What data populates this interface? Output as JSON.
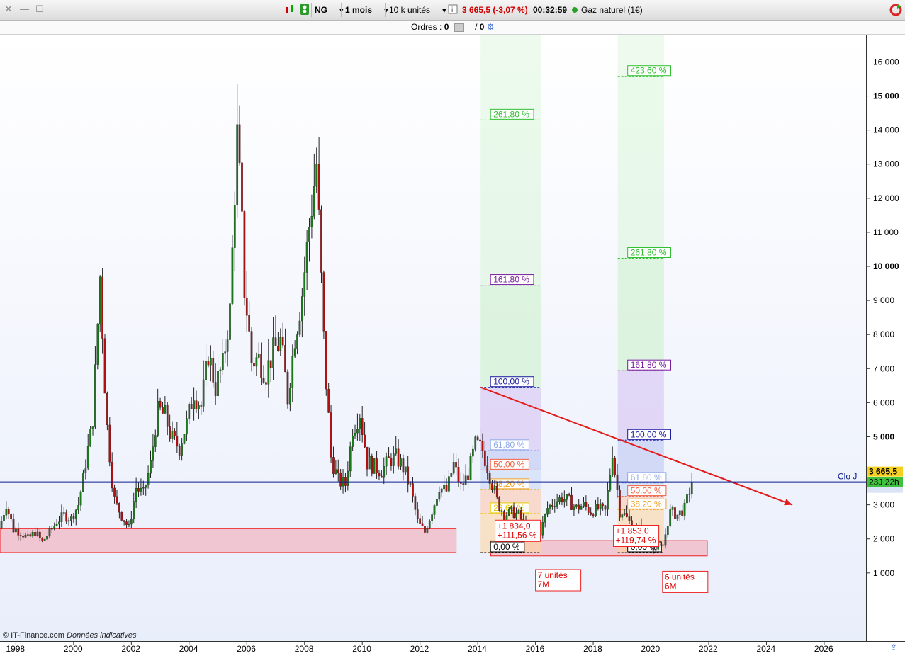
{
  "toolbar": {
    "symbol": "NG",
    "period": "1 mois",
    "units": "10 k unités",
    "price_change": "3 665,5 (-3,07 %)",
    "timer": "00:32:59",
    "instrument": "Gaz naturel (1€)",
    "orders_label": "Ordres :",
    "orders_a": "0",
    "orders_b": "0",
    "orders_sep": "/"
  },
  "footer": {
    "source": "© IT-Finance.com",
    "note": "Données indicatives"
  },
  "price_tags": {
    "last": "3 665,5",
    "countdown": "23J 22h",
    "clo_label": "Clo J",
    "hidden_tag": "3 665,5"
  },
  "colors": {
    "up": "#1a7a1a",
    "down": "#b01010",
    "clo_line": "#0b1f8f",
    "trend": "#e31b1b",
    "support_zone": "#f2aab5"
  },
  "chart_data": {
    "type": "candlestick",
    "title": "",
    "y_ticks": [
      1000,
      2000,
      3000,
      4000,
      5000,
      6000,
      7000,
      8000,
      9000,
      10000,
      11000,
      12000,
      13000,
      14000,
      15000,
      16000
    ],
    "y_tick_labels": [
      "1 000",
      "2 000",
      "3 000",
      "4 000",
      "5 000",
      "6 000",
      "7 000",
      "8 000",
      "9 000",
      "10 000",
      "11 000",
      "12 000",
      "13 000",
      "14 000",
      "15 000",
      "16 000"
    ],
    "y_tick_bold": [
      false,
      false,
      false,
      false,
      true,
      false,
      false,
      false,
      false,
      true,
      false,
      false,
      false,
      false,
      true,
      false
    ],
    "ylim": [
      -1000,
      16800
    ],
    "x_ticks": [
      1998,
      2000,
      2002,
      2004,
      2006,
      2008,
      2010,
      2012,
      2014,
      2016,
      2018,
      2020,
      2022,
      2024,
      2026
    ],
    "xlim": [
      1997.45,
      2027.45
    ],
    "last_price": 3665.5,
    "monthly_closes": [
      [
        1997.5,
        2300
      ],
      [
        1997.75,
        3000
      ],
      [
        1998.0,
        2300
      ],
      [
        1998.25,
        2200
      ],
      [
        1998.5,
        2000
      ],
      [
        1998.75,
        2200
      ],
      [
        1999.0,
        1900
      ],
      [
        1999.25,
        2200
      ],
      [
        1999.5,
        2500
      ],
      [
        1999.75,
        2700
      ],
      [
        2000.0,
        2600
      ],
      [
        2000.25,
        3000
      ],
      [
        2000.5,
        4200
      ],
      [
        2000.75,
        5500
      ],
      [
        2001.0,
        9700
      ],
      [
        2001.25,
        5200
      ],
      [
        2001.5,
        3100
      ],
      [
        2001.75,
        2700
      ],
      [
        2002.0,
        2300
      ],
      [
        2002.25,
        3500
      ],
      [
        2002.5,
        3300
      ],
      [
        2002.75,
        4200
      ],
      [
        2003.0,
        5800
      ],
      [
        2003.25,
        5600
      ],
      [
        2003.5,
        4900
      ],
      [
        2003.75,
        4700
      ],
      [
        2004.0,
        5400
      ],
      [
        2004.25,
        6300
      ],
      [
        2004.5,
        5900
      ],
      [
        2004.75,
        7400
      ],
      [
        2005.0,
        6500
      ],
      [
        2005.25,
        7100
      ],
      [
        2005.5,
        8700
      ],
      [
        2005.75,
        13900
      ],
      [
        2006.0,
        9500
      ],
      [
        2006.25,
        7200
      ],
      [
        2006.5,
        7300
      ],
      [
        2006.75,
        6900
      ],
      [
        2007.0,
        7500
      ],
      [
        2007.25,
        7800
      ],
      [
        2007.5,
        6200
      ],
      [
        2007.75,
        7900
      ],
      [
        2008.0,
        9200
      ],
      [
        2008.25,
        11200
      ],
      [
        2008.5,
        13000
      ],
      [
        2008.75,
        7700
      ],
      [
        2009.0,
        4400
      ],
      [
        2009.25,
        3700
      ],
      [
        2009.5,
        3600
      ],
      [
        2009.75,
        5200
      ],
      [
        2010.0,
        5700
      ],
      [
        2010.25,
        4300
      ],
      [
        2010.5,
        4100
      ],
      [
        2010.75,
        4000
      ],
      [
        2011.0,
        4300
      ],
      [
        2011.25,
        4400
      ],
      [
        2011.5,
        4100
      ],
      [
        2011.75,
        3500
      ],
      [
        2012.0,
        2500
      ],
      [
        2012.25,
        2200
      ],
      [
        2012.5,
        2800
      ],
      [
        2012.75,
        3500
      ],
      [
        2013.0,
        3400
      ],
      [
        2013.25,
        4200
      ],
      [
        2013.5,
        3500
      ],
      [
        2013.75,
        3900
      ],
      [
        2014.0,
        4800
      ],
      [
        2014.25,
        4600
      ],
      [
        2014.5,
        3900
      ],
      [
        2014.75,
        3100
      ],
      [
        2015.0,
        2700
      ],
      [
        2015.25,
        2800
      ],
      [
        2015.5,
        2700
      ],
      [
        2015.75,
        2300
      ],
      [
        2016.0,
        2000
      ],
      [
        2016.25,
        2200
      ],
      [
        2016.5,
        2900
      ],
      [
        2016.75,
        3100
      ],
      [
        2017.0,
        3200
      ],
      [
        2017.25,
        3100
      ],
      [
        2017.5,
        2900
      ],
      [
        2017.75,
        3000
      ],
      [
        2018.0,
        2800
      ],
      [
        2018.25,
        2900
      ],
      [
        2018.5,
        2800
      ],
      [
        2018.75,
        4500
      ],
      [
        2019.0,
        2900
      ],
      [
        2019.25,
        2600
      ],
      [
        2019.5,
        2300
      ],
      [
        2019.75,
        2300
      ],
      [
        2020.0,
        1900
      ],
      [
        2020.25,
        1700
      ],
      [
        2020.5,
        1800
      ],
      [
        2020.75,
        2800
      ],
      [
        2021.0,
        2700
      ],
      [
        2021.25,
        2900
      ],
      [
        2021.5,
        3665
      ]
    ],
    "support_zones": [
      {
        "x0": 1997.45,
        "x1": 2013.25,
        "y0": 1600,
        "y1": 2300
      },
      {
        "x0": 2014.45,
        "x1": 2021.95,
        "y0": 1500,
        "y1": 1950
      }
    ],
    "trendline": {
      "x0": 2014.1,
      "y0": 6450,
      "x1": 2024.9,
      "y1": 3000
    },
    "fib_projections": [
      {
        "x0": 2014.1,
        "x1": 2016.2,
        "base": 1600,
        "ref": 6450,
        "levels": [
          {
            "label": "0,00 %",
            "ratio": 0,
            "color": "#000000"
          },
          {
            "label": "23,60 %",
            "ratio": 0.236,
            "color": "#e8c800"
          },
          {
            "label": "38,20 %",
            "ratio": 0.382,
            "color": "#f0a020"
          },
          {
            "label": "50,00 %",
            "ratio": 0.5,
            "color": "#f06040"
          },
          {
            "label": "61,80 %",
            "ratio": 0.618,
            "color": "#8fa8e8"
          },
          {
            "label": "100,00 %",
            "ratio": 1.0,
            "color": "#1a1aa0"
          },
          {
            "label": "161,80 %",
            "ratio": 1.618,
            "color": "#7a1aa0"
          },
          {
            "label": "261,80 %",
            "ratio": 2.618,
            "color": "#30c030"
          }
        ]
      },
      {
        "x0": 2018.85,
        "x1": 2020.45,
        "base": 1600,
        "ref": 4900,
        "levels": [
          {
            "label": "0,00 %",
            "ratio": 0,
            "color": "#000000"
          },
          {
            "label": "38,20 %",
            "ratio": 0.382,
            "color": "#f0a020"
          },
          {
            "label": "50,00 %",
            "ratio": 0.5,
            "color": "#f06040"
          },
          {
            "label": "61,80 %",
            "ratio": 0.618,
            "color": "#8fa8e8"
          },
          {
            "label": "100,00 %",
            "ratio": 1.0,
            "color": "#1a1aa0"
          },
          {
            "label": "161,80 %",
            "ratio": 1.618,
            "color": "#7a1aa0"
          },
          {
            "label": "261,80 %",
            "ratio": 2.618,
            "color": "#30c030"
          },
          {
            "label": "423,60 %",
            "ratio": 4.236,
            "color": "#30c030"
          }
        ]
      }
    ],
    "annotations": [
      {
        "x": 2014.6,
        "y": 2550,
        "lines": [
          "+1 834,0",
          "+111,56 %"
        ]
      },
      {
        "x": 2018.7,
        "y": 2400,
        "lines": [
          "+1 853,0",
          "+119,74 %"
        ]
      },
      {
        "x": 2016.0,
        "y": 1100,
        "lines": [
          "7 unités",
          "7M"
        ]
      },
      {
        "x": 2020.4,
        "y": 1050,
        "lines": [
          "6 unités",
          "6M"
        ]
      }
    ]
  }
}
